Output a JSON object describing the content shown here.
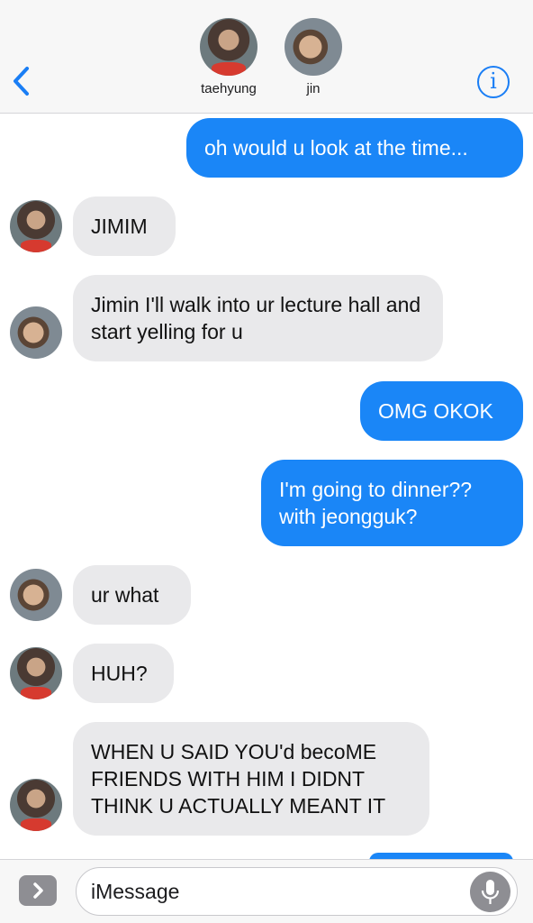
{
  "header": {
    "back_icon": "chevron-left-icon",
    "info_icon": "info-icon",
    "accent_color": "#1a7ef5",
    "contacts": [
      {
        "name": "taehyung"
      },
      {
        "name": "jin"
      }
    ]
  },
  "messages": [
    {
      "side": "sent",
      "text": "oh would u look at the time..."
    },
    {
      "side": "received",
      "sender": "taehyung",
      "text": "JIMIM"
    },
    {
      "side": "received",
      "sender": "jin",
      "text": "Jimin I'll walk into ur lecture hall and start yelling for u"
    },
    {
      "side": "sent",
      "text": "OMG OKOK"
    },
    {
      "side": "sent",
      "text": "I'm going to dinner?? with jeongguk?"
    },
    {
      "side": "received",
      "sender": "jin",
      "text": "ur what"
    },
    {
      "side": "received",
      "sender": "taehyung",
      "text": "HUH?"
    },
    {
      "side": "received",
      "sender": "taehyung",
      "text": "WHEN U SAID YOU'd becoME FRIENDS WITH HIM I DIDNT THINK U ACTUALLY MEANT IT"
    }
  ],
  "input": {
    "placeholder": "iMessage",
    "apps_icon": "chevron-right-icon",
    "mic_icon": "microphone-icon"
  },
  "colors": {
    "sent_bubble": "#1a86f7",
    "received_bubble": "#e9e9eb"
  }
}
